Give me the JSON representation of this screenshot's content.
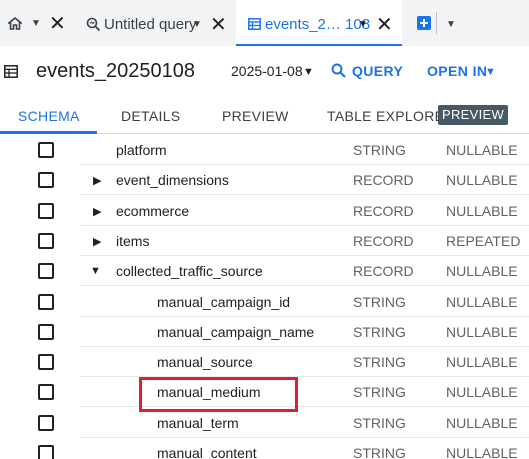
{
  "tabbar": {
    "home_tab": {
      "icon": "home-icon"
    },
    "query_tab": {
      "label": "Untitled query",
      "icon": "query-icon"
    },
    "events_tab": {
      "label": "events_2… 108",
      "icon": "table-icon"
    },
    "add_icon": "plus-icon"
  },
  "header": {
    "table_icon": "table-icon",
    "title": "events_20250108",
    "date": "2025-01-08",
    "query_label": "QUERY",
    "open_in_label": "OPEN IN"
  },
  "subtabs": {
    "schema": "SCHEMA",
    "details": "DETAILS",
    "preview": "PREVIEW",
    "table_explorer": "TABLE EXPLORER",
    "preview_badge": "PREVIEW"
  },
  "schema": {
    "rows": [
      {
        "name": "platform",
        "type": "STRING",
        "mode": "NULLABLE",
        "expander": ""
      },
      {
        "name": "event_dimensions",
        "type": "RECORD",
        "mode": "NULLABLE",
        "expander": "collapsed"
      },
      {
        "name": "ecommerce",
        "type": "RECORD",
        "mode": "NULLABLE",
        "expander": "collapsed"
      },
      {
        "name": "items",
        "type": "RECORD",
        "mode": "REPEATED",
        "expander": "collapsed"
      },
      {
        "name": "collected_traffic_source",
        "type": "RECORD",
        "mode": "NULLABLE",
        "expander": "expanded"
      },
      {
        "name": "manual_campaign_id",
        "type": "STRING",
        "mode": "NULLABLE",
        "expander": ""
      },
      {
        "name": "manual_campaign_name",
        "type": "STRING",
        "mode": "NULLABLE",
        "expander": ""
      },
      {
        "name": "manual_source",
        "type": "STRING",
        "mode": "NULLABLE",
        "expander": ""
      },
      {
        "name": "manual_medium",
        "type": "STRING",
        "mode": "NULLABLE",
        "expander": ""
      },
      {
        "name": "manual_term",
        "type": "STRING",
        "mode": "NULLABLE",
        "expander": ""
      },
      {
        "name": "manual_content",
        "type": "STRING",
        "mode": "NULLABLE",
        "expander": ""
      }
    ]
  },
  "colors": {
    "accent": "#1a73e8",
    "highlight": "#e0202b",
    "badge": "#455a64"
  }
}
